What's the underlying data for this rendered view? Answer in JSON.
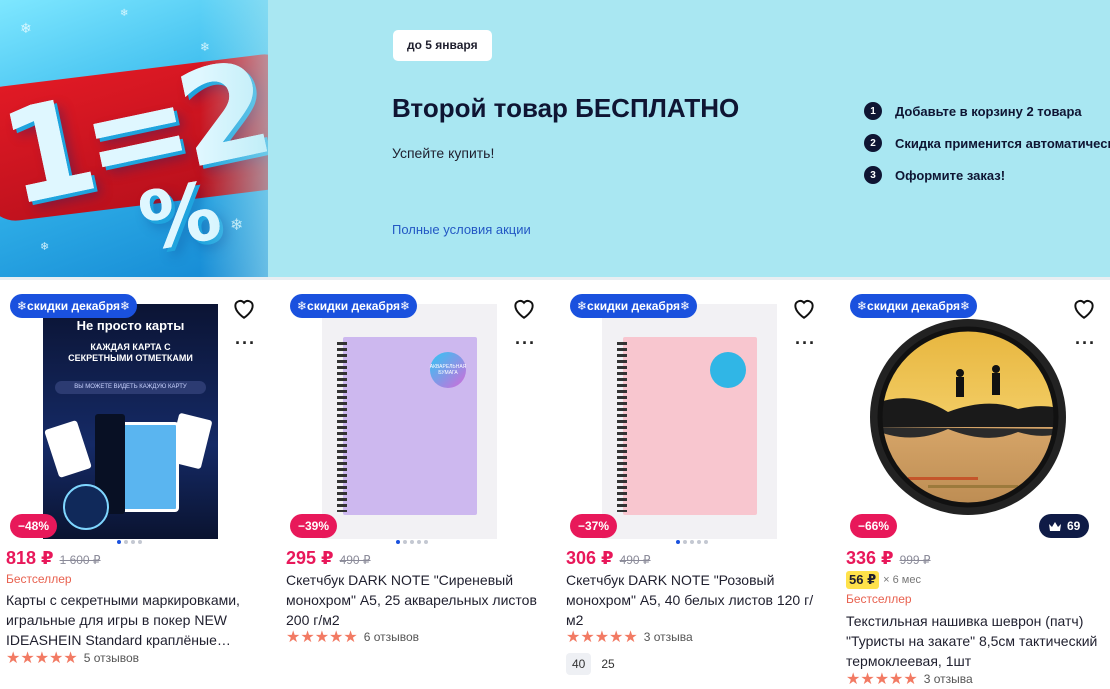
{
  "banner": {
    "art_text": "1=2",
    "art_percent": "%",
    "date_chip": "до 5 января",
    "title": "Второй товар БЕСПЛАТНО",
    "subtitle": "Успейте купить!",
    "conditions_link": "Полные условия акции",
    "steps": [
      {
        "num": "1",
        "text": "Добавьте в корзину 2 товара"
      },
      {
        "num": "2",
        "text": "Скидка применится автоматически"
      },
      {
        "num": "3",
        "text": "Оформите заказ!"
      }
    ]
  },
  "products": [
    {
      "chip": "❄скидки декабря❄",
      "discount": "−48%",
      "price": "818 ₽",
      "old_price": "1 600 ₽",
      "bestseller": "Бестселлер",
      "title": "Карты с секретными маркировками, игральные для игры в покер NEW IDEASHEIN Standard краплёные…",
      "stars": "★★★★★",
      "reviews": "5 отзывов",
      "image_text": {
        "headline": "Не просто карты",
        "sub": "КАЖДАЯ КАРТА С СЕКРЕТНЫМИ ОТМЕТКАМИ",
        "caption": "ВЫ МОЖЕТЕ ВИДЕТЬ КАЖДУЮ КАРТУ"
      }
    },
    {
      "chip": "❄скидки декабря❄",
      "discount": "−39%",
      "price": "295 ₽",
      "old_price": "490 ₽",
      "title": "Скетчбук DARK NOTE \"Сиреневый монохром\" А5, 25 акварельных листов 200 г/м2",
      "stars": "★★★★★",
      "reviews": "6 отзывов",
      "sticker_text": "АКВАРЕЛЬНАЯ БУМАГА"
    },
    {
      "chip": "❄скидки декабря❄",
      "discount": "−37%",
      "price": "306 ₽",
      "old_price": "490 ₽",
      "title": "Скетчбук DARK NOTE \"Розовый монохром\" А5, 40 белых листов 120 г/м2",
      "stars": "★★★★★",
      "reviews": "3 отзыва",
      "sizes": [
        "40",
        "25"
      ]
    },
    {
      "chip": "❄скидки декабря❄",
      "discount": "−66%",
      "badge": "69",
      "price": "336 ₽",
      "old_price": "999 ₽",
      "installment_price": "56 ₽",
      "installment_term": "× 6 мес",
      "bestseller": "Бестселлер",
      "title": "Текстильная нашивка шеврон (патч) \"Туристы на закате\" 8,5см тактический термоклеевая, 1шт",
      "stars": "★★★★★",
      "reviews": "3 отзыва"
    }
  ],
  "colors": {
    "banner_bg": "#a9e7f2",
    "chip_blue": "#1a51de",
    "discount_pink": "#e8185a",
    "price_pink": "#e8185a",
    "star": "#f27a63"
  }
}
